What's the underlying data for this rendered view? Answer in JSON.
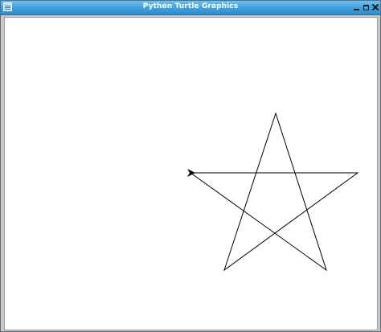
{
  "window": {
    "title": "Python Turtle Graphics",
    "icons": {
      "menu": "window-menu-icon",
      "minimize": "minimize-icon",
      "maximize": "maximize-icon",
      "close": "close-icon"
    }
  },
  "canvas": {
    "background": "#ffffff",
    "drawing": {
      "shape": "star",
      "points": 5,
      "stroke_color": "#000000"
    },
    "turtle": {
      "icon": "turtle-arrow-icon",
      "color": "#000000",
      "heading": "right"
    }
  }
}
